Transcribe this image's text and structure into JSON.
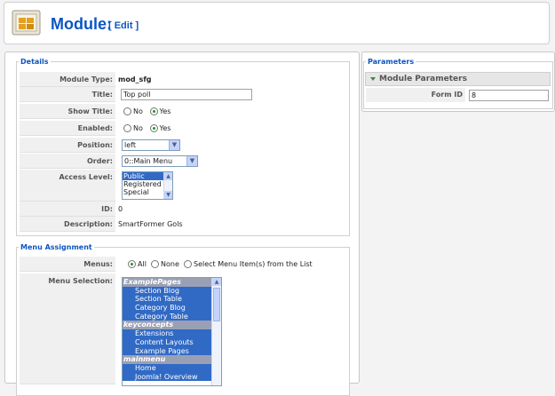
{
  "header": {
    "title": "Module:",
    "edit": "[ Edit ]"
  },
  "details": {
    "legend": "Details",
    "module_type": {
      "label": "Module Type:",
      "value": "mod_sfg"
    },
    "title": {
      "label": "Title:",
      "value": "Top poll"
    },
    "show_title": {
      "label": "Show Title:",
      "no": "No",
      "yes": "Yes"
    },
    "enabled": {
      "label": "Enabled:",
      "no": "No",
      "yes": "Yes"
    },
    "position": {
      "label": "Position:",
      "value": "left"
    },
    "order": {
      "label": "Order:",
      "value": "0::Main Menu"
    },
    "access_level": {
      "label": "Access Level:",
      "options": [
        "Public",
        "Registered",
        "Special"
      ]
    },
    "id": {
      "label": "ID:",
      "value": "0"
    },
    "description": {
      "label": "Description:",
      "value": "SmartFormer Gols"
    }
  },
  "menu_assignment": {
    "legend": "Menu Assignment",
    "menus": {
      "label": "Menus:",
      "all": "All",
      "none": "None",
      "select": "Select Menu Item(s) from the List"
    },
    "selection": {
      "label": "Menu Selection:",
      "items": [
        {
          "type": "group",
          "text": "ExamplePages"
        },
        {
          "type": "item",
          "text": "Section Blog"
        },
        {
          "type": "item",
          "text": "Section Table"
        },
        {
          "type": "item",
          "text": "Category Blog"
        },
        {
          "type": "item",
          "text": "Category Table"
        },
        {
          "type": "group",
          "text": "keyconcepts"
        },
        {
          "type": "item",
          "text": "Extensions"
        },
        {
          "type": "item",
          "text": "Content Layouts"
        },
        {
          "type": "item",
          "text": "Example Pages"
        },
        {
          "type": "group",
          "text": "mainmenu"
        },
        {
          "type": "item",
          "text": "Home"
        },
        {
          "type": "item",
          "text": "Joomla! Overview"
        }
      ]
    }
  },
  "parameters": {
    "legend": "Parameters",
    "section_title": "Module Parameters",
    "form_id": {
      "label": "Form ID",
      "value": "8"
    }
  }
}
